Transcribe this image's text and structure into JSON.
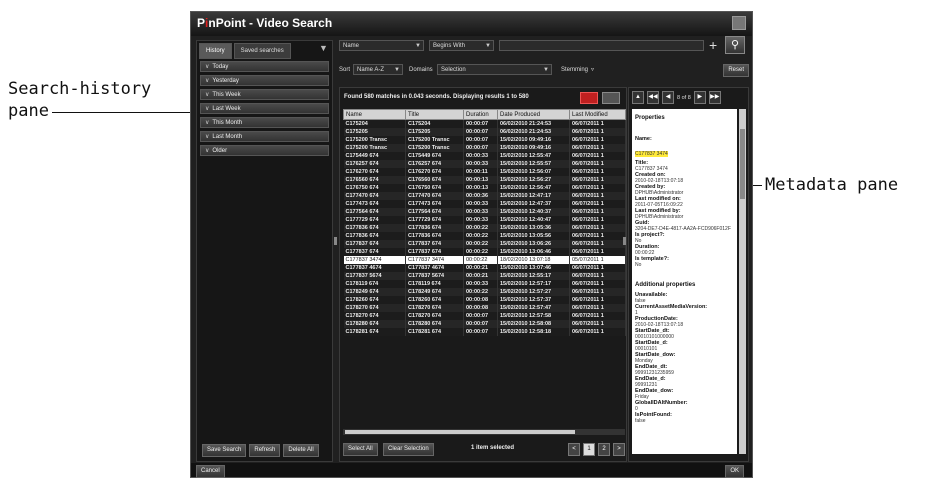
{
  "callouts": {
    "search_history_l1": "Search-history",
    "search_history_l2": "pane",
    "metadata": "Metadata pane"
  },
  "window": {
    "title_prefix": "P",
    "title_accent": "i",
    "title_rest": "nPoint - Video Search"
  },
  "left": {
    "tabs": [
      "History",
      "Saved searches"
    ],
    "history": [
      "Today",
      "Yesterday",
      "This Week",
      "Last Week",
      "This Month",
      "Last Month",
      "Older"
    ],
    "buttons": {
      "save": "Save Search",
      "refresh": "Refresh",
      "delete": "Delete All"
    }
  },
  "search": {
    "field": "Name",
    "operator": "Begins With",
    "sort_label": "Sort",
    "sort_value": "Name A-Z",
    "domains_label": "Domains",
    "domains_value": "Selection",
    "stemming_label": "Stemming",
    "reset": "Reset"
  },
  "results": {
    "found_text": "Found 580 matches in 0.043 seconds. Displaying results 1 to 580",
    "columns": [
      "Name",
      "Title",
      "Duration",
      "Date Produced",
      "Last Modified"
    ],
    "rows": [
      [
        "C175204",
        "C175204",
        "00:00:07",
        "06/02/2010 21:24:53",
        "06/07/2011 1"
      ],
      [
        "C175205",
        "C175205",
        "00:00:07",
        "06/02/2010 21:24:53",
        "06/07/2011 1"
      ],
      [
        "C175200 Transc",
        "C175200 Transc",
        "00:00:07",
        "15/02/2010 09:49:16",
        "06/07/2011 1"
      ],
      [
        "C175200 Transc",
        "C175200 Transc",
        "00:00:07",
        "15/02/2010 09:49:16",
        "06/07/2011 1"
      ],
      [
        "C175449 674",
        "C175449 674",
        "00:00:33",
        "15/02/2010 12:55:47",
        "06/07/2011 1"
      ],
      [
        "C176257 674",
        "C176257 674",
        "00:00:33",
        "15/02/2010 12:55:57",
        "06/07/2011 1"
      ],
      [
        "C176270 674",
        "C176270 674",
        "00:00:11",
        "15/02/2010 12:56:07",
        "06/07/2011 1"
      ],
      [
        "C176560 674",
        "C176560 674",
        "00:00:13",
        "15/02/2010 12:56:27",
        "06/07/2011 1"
      ],
      [
        "C176750 674",
        "C176750 674",
        "00:00:13",
        "15/02/2010 12:56:47",
        "06/07/2011 1"
      ],
      [
        "C177470 674",
        "C177470 674",
        "00:00:36",
        "15/02/2010 12:47:17",
        "06/07/2011 1"
      ],
      [
        "C177473 674",
        "C177473 674",
        "00:00:33",
        "15/02/2010 12:47:37",
        "06/07/2011 1"
      ],
      [
        "C177564 674",
        "C177564 674",
        "00:00:33",
        "15/02/2010 12:40:37",
        "06/07/2011 1"
      ],
      [
        "C177729 674",
        "C177729 674",
        "00:00:33",
        "15/02/2010 12:40:47",
        "06/07/2011 1"
      ],
      [
        "C177836 674",
        "C177836 674",
        "00:00:22",
        "15/02/2010 13:05:36",
        "06/07/2011 1"
      ],
      [
        "C177836 674",
        "C177836 674",
        "00:00:22",
        "15/02/2010 13:05:56",
        "06/07/2011 1"
      ],
      [
        "C177837 674",
        "C177837 674",
        "00:00:22",
        "15/02/2010 13:06:26",
        "06/07/2011 1"
      ],
      [
        "C177837 674",
        "C177837 674",
        "00:00:22",
        "15/02/2010 13:06:46",
        "06/07/2011 1"
      ],
      [
        "C177837 3474",
        "C177837 3474",
        "00:00:22",
        "18/02/2010 13:07:18",
        "05/07/2011 1"
      ],
      [
        "C177837 4674",
        "C177837 4674",
        "00:00:21",
        "15/02/2010 13:07:46",
        "06/07/2011 1"
      ],
      [
        "C177837 5674",
        "C177837 5674",
        "00:00:21",
        "15/02/2010 12:55:17",
        "06/07/2011 1"
      ],
      [
        "C178119 674",
        "C178119 674",
        "00:00:33",
        "15/02/2010 12:57:17",
        "06/07/2011 1"
      ],
      [
        "C178249 674",
        "C178249 674",
        "00:00:22",
        "15/02/2010 12:57:27",
        "06/07/2011 1"
      ],
      [
        "C178260 674",
        "C178260 674",
        "00:00:08",
        "15/02/2010 12:57:37",
        "06/07/2011 1"
      ],
      [
        "C178270 674",
        "C178270 674",
        "00:00:08",
        "15/02/2010 12:57:47",
        "06/07/2011 1"
      ],
      [
        "C178270 674",
        "C178270 674",
        "00:00:07",
        "15/02/2010 12:57:58",
        "06/07/2011 1"
      ],
      [
        "C178280 674",
        "C178280 674",
        "00:00:07",
        "15/02/2010 12:58:08",
        "06/07/2011 1"
      ],
      [
        "C178281 674",
        "C178281 674",
        "00:00:07",
        "15/02/2010 12:58:18",
        "06/07/2011 1"
      ]
    ],
    "selected_row": 17,
    "select_all": "Select All",
    "clear_selection": "Clear Selection",
    "status": "1 item selected",
    "pages": [
      "<",
      "1",
      "2",
      ">"
    ]
  },
  "metadata": {
    "counter": "8 of 8",
    "properties_title": "Properties",
    "fields": [
      {
        "key": "Name:",
        "value": "C177837 3474",
        "highlight": true
      },
      {
        "key": "Title:",
        "value": "C177837 3474"
      },
      {
        "key": "Created on:",
        "value": "2010-02-18T13:07:18"
      },
      {
        "key": "Created by:",
        "value": "DPHUB\\Administrator"
      },
      {
        "key": "Last modified on:",
        "value": "2011-07-05T16:09:22"
      },
      {
        "key": "Last modified by:",
        "value": "DPHUB\\Administrator"
      },
      {
        "key": "Guid:",
        "value": "3204-DE7-D4E-4817-AA2A-FCD906F012F"
      },
      {
        "key": "Is project?:",
        "value": "No"
      },
      {
        "key": "Duration:",
        "value": "00:00:22"
      },
      {
        "key": "Is template?:",
        "value": "No"
      }
    ],
    "additional_title": "Additional properties",
    "additional": [
      {
        "key": "Unavailable:",
        "value": "false"
      },
      {
        "key": "CurrentAssetMediaVersion:",
        "value": "1"
      },
      {
        "key": "ProductionDate:",
        "value": "2010-02-18T13:07:18"
      },
      {
        "key": "StartDate_dt:",
        "value": "00010101000000"
      },
      {
        "key": "StartDate_d:",
        "value": "00010101"
      },
      {
        "key": "StartDate_dow:",
        "value": "Monday"
      },
      {
        "key": "EndDate_dt:",
        "value": "99991231235959"
      },
      {
        "key": "EndDate_d:",
        "value": "99991231"
      },
      {
        "key": "EndDate_dow:",
        "value": "Friday"
      },
      {
        "key": "GlobalIDAltNumber:",
        "value": "0"
      },
      {
        "key": "IsPointFound:",
        "value": "false"
      }
    ]
  },
  "footer": {
    "cancel": "Cancel",
    "ok": "OK"
  }
}
